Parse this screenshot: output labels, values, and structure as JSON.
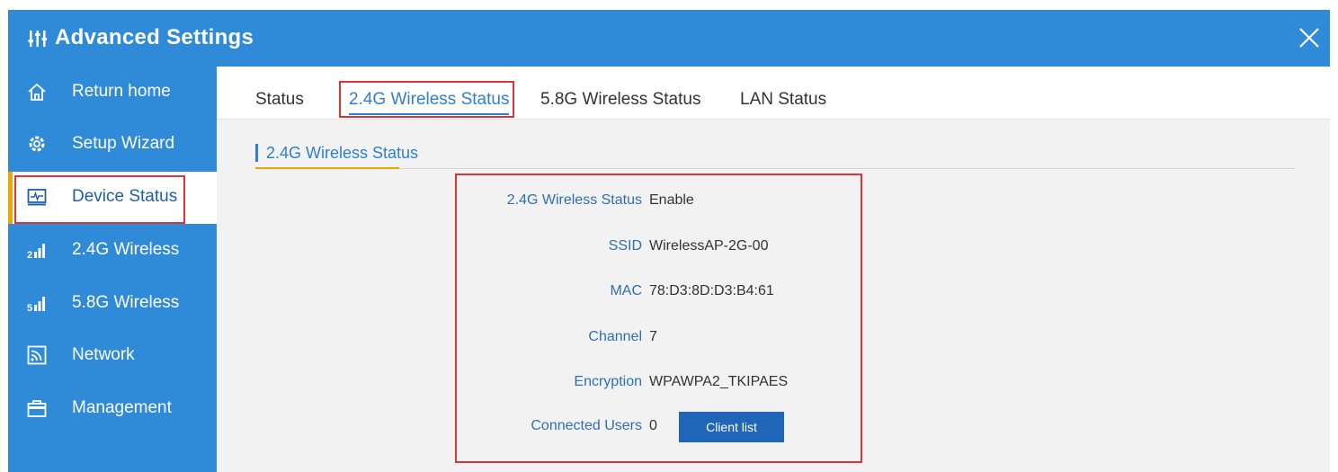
{
  "header": {
    "title": "Advanced Settings"
  },
  "sidebar": {
    "items": [
      {
        "label": "Return home",
        "icon": "home-icon"
      },
      {
        "label": "Setup Wizard",
        "icon": "gear-icon"
      },
      {
        "label": "Device Status",
        "icon": "monitor-icon",
        "active": true
      },
      {
        "label": "2.4G Wireless",
        "icon": "signal-2g-icon"
      },
      {
        "label": "5.8G Wireless",
        "icon": "signal-5g-icon"
      },
      {
        "label": "Network",
        "icon": "network-icon"
      },
      {
        "label": "Management",
        "icon": "briefcase-icon"
      }
    ]
  },
  "tabs": [
    {
      "label": "Status"
    },
    {
      "label": "2.4G Wireless Status",
      "active": true
    },
    {
      "label": "5.8G Wireless Status"
    },
    {
      "label": "LAN Status"
    }
  ],
  "section": {
    "title": "2.4G Wireless Status"
  },
  "status": {
    "wireless_status_label": "2.4G Wireless Status",
    "wireless_status_value": "Enable",
    "ssid_label": "SSID",
    "ssid_value": "WirelessAP-2G-00",
    "mac_label": "MAC",
    "mac_value": "78:D3:8D:D3:B4:61",
    "channel_label": "Channel",
    "channel_value": "7",
    "encryption_label": "Encryption",
    "encryption_value": "WPAWPA2_TKIPAES",
    "users_label": "Connected Users",
    "users_value": "0",
    "client_list_label": "Client list"
  },
  "colors": {
    "primary": "#2f8ad8",
    "accent": "#f0a500",
    "highlight": "#e0343a",
    "button": "#1f66b8"
  }
}
